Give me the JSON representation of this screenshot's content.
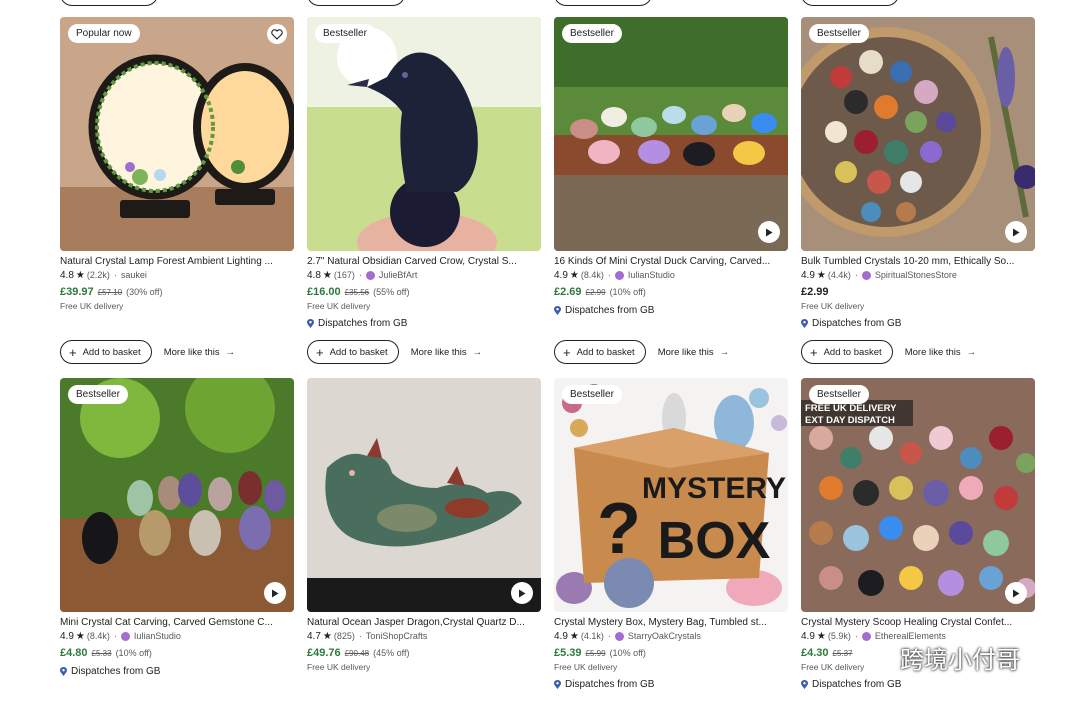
{
  "labels": {
    "add_to_basket": "Add to basket",
    "more_like_this": "More like this"
  },
  "colors": {
    "price_sale": "#2d7a3e",
    "seller_icon": "#a46bd1",
    "rating_text": "#222222"
  },
  "icons": {
    "star": "star-icon",
    "heart": "heart-icon",
    "play": "play-icon",
    "pin": "map-pin-icon",
    "arrow": "arrow-right-icon",
    "plus": "plus-icon"
  },
  "products": [
    {
      "badge": "Popular now",
      "title": "Natural Crystal Lamp Forest Ambient Lighting ...",
      "rating": "4.8",
      "reviews": "(2.2k)",
      "seller": "saukei",
      "price": "£39.97",
      "old_price": "£57.10",
      "discount": "(30% off)",
      "delivery": "Free UK delivery"
    },
    {
      "badge": "Bestseller",
      "title": "2.7\" Natural Obsidian Carved Crow, Crystal S...",
      "rating": "4.8",
      "reviews": "(167)",
      "seller": "JulieBfArt",
      "price": "£16.00",
      "old_price": "£35.56",
      "discount": "(55% off)",
      "delivery": "Free UK delivery",
      "dispatch": "Dispatches from GB"
    },
    {
      "badge": "Bestseller",
      "title": "16 Kinds Of Mini Crystal Duck Carving, Carved...",
      "rating": "4.9",
      "reviews": "(8.4k)",
      "seller": "IulianStudio",
      "price": "£2.69",
      "old_price": "£2.99",
      "discount": "(10% off)",
      "dispatch": "Dispatches from GB"
    },
    {
      "badge": "Bestseller",
      "title": "Bulk Tumbled Crystals 10-20 mm, Ethically So...",
      "rating": "4.9",
      "reviews": "(4.4k)",
      "seller": "SpiritualStonesStore",
      "price": "£2.99",
      "delivery": "Free UK delivery",
      "dispatch": "Dispatches from GB"
    },
    {
      "badge": "Bestseller",
      "title": "Mini Crystal Cat Carving, Carved Gemstone C...",
      "rating": "4.9",
      "reviews": "(8.4k)",
      "seller": "IulianStudio",
      "price": "£4.80",
      "old_price": "£5.33",
      "discount": "(10% off)",
      "dispatch": "Dispatches from GB"
    },
    {
      "title": "Natural Ocean Jasper Dragon,Crystal Quartz D...",
      "rating": "4.7",
      "reviews": "(825)",
      "seller": "ToniShopCrafts",
      "price": "£49.76",
      "old_price": "£90.48",
      "discount": "(45% off)",
      "delivery": "Free UK delivery"
    },
    {
      "badge": "Bestseller",
      "title": "Crystal Mystery Box, Mystery Bag, Tumbled st...",
      "rating": "4.9",
      "reviews": "(4.1k)",
      "seller": "StarryOakCrystals",
      "price": "£5.39",
      "old_price": "£5.99",
      "discount": "(10% off)",
      "delivery": "Free UK delivery",
      "dispatch": "Dispatches from GB",
      "image_text_1": "MYSTERY",
      "image_text_2": "BOX",
      "image_text_3": "?"
    },
    {
      "badge": "Bestseller",
      "title": "Crystal Mystery Scoop Healing Crystal Confet...",
      "rating": "4.9",
      "reviews": "(5.9k)",
      "seller": "EtherealElements",
      "price": "£4.30",
      "old_price": "£5.37",
      "delivery": "Free UK delivery",
      "dispatch": "Dispatches from GB",
      "image_text_1": "FREE UK DELIVERY",
      "image_text_2": "EXT DAY DISPATCH"
    }
  ],
  "watermark": "跨境小付哥"
}
